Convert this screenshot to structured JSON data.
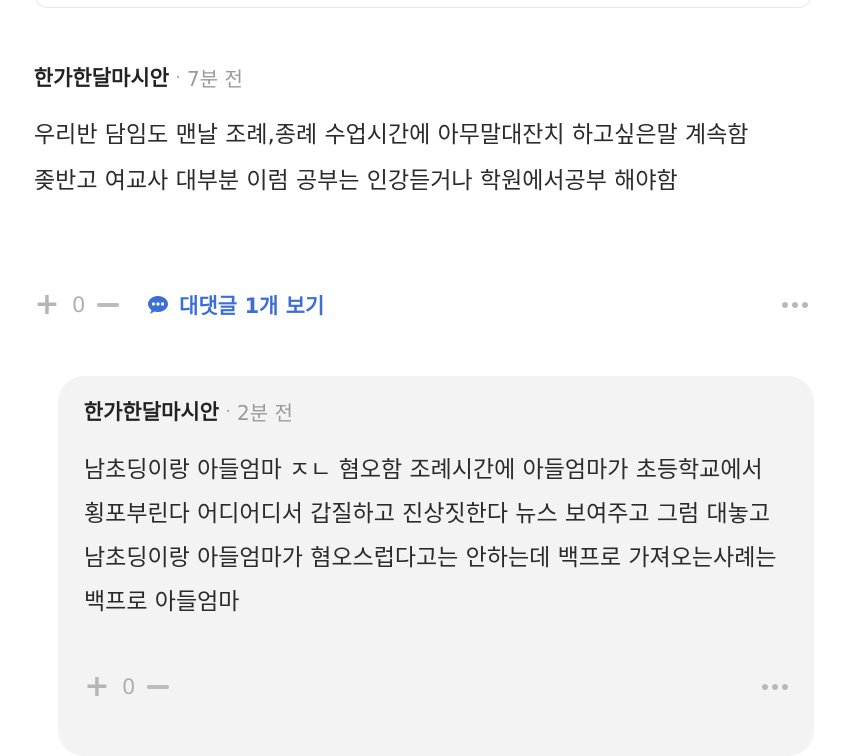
{
  "comment": {
    "author": "한가한달마시안",
    "separator": "·",
    "time": "7분 전",
    "text": "우리반 담임도 맨날 조례,종례 수업시간에 아무말대잔치 하고싶은말 계속함 좆반고 여교사 대부분 이럼 공부는 인강듣거나 학원에서공부 해야함",
    "vote_count": "0",
    "replies_label": "대댓글 1개 보기",
    "icons": {
      "upvote": "plus-icon",
      "downvote": "minus-icon",
      "replies": "chat-bubble-icon",
      "more": "more-dots-icon"
    },
    "accent_color": "#3b6fd6"
  },
  "reply": {
    "author": "한가한달마시안",
    "separator": "·",
    "time": "2분 전",
    "text": "남초딩이랑 아들엄마 ㅈㄴ 혐오함 조례시간에 아들엄마가 초등학교에서 횡포부린다 어디어디서 갑질하고 진상짓한다 뉴스 보여주고 그럼 대놓고 남초딩이랑 아들엄마가 혐오스럽다고는 안하는데 백프로 가져오는사례는 백프로 아들엄마",
    "vote_count": "0",
    "background_color": "#f3f3f3"
  }
}
